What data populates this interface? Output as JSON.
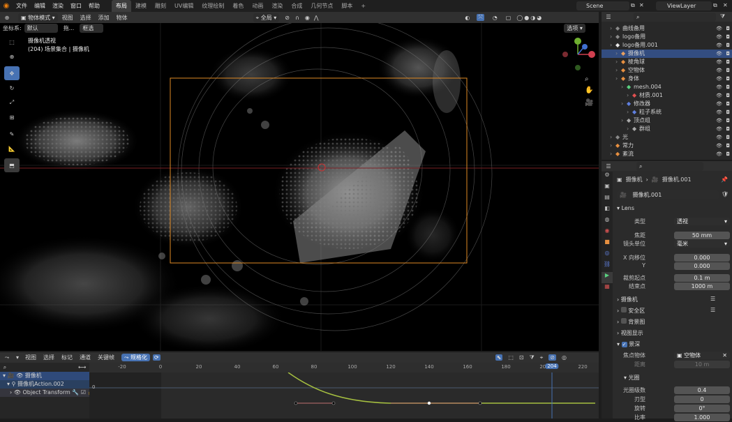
{
  "topbar": {
    "menus": [
      "文件",
      "编辑",
      "渲染",
      "窗口",
      "帮助"
    ],
    "workspaces": [
      "布局",
      "建模",
      "雕刻",
      "UV编辑",
      "纹理绘制",
      "着色",
      "动画",
      "渲染",
      "合成",
      "几何节点",
      "脚本"
    ],
    "active_workspace": "布局",
    "scene": "Scene",
    "view_layer": "ViewLayer"
  },
  "viewport": {
    "mode": "物体模式",
    "menus": [
      "视图",
      "选择",
      "添加",
      "物体"
    ],
    "transform_orientation_label": "坐标系:",
    "transform_orientation": "默认",
    "drag_label": "拖...",
    "select_mode": "框选",
    "pivot": "全局",
    "options": "选项",
    "overlay_title": "摄像机透视",
    "overlay_subtitle": "(204) 场景集合 | 摄像机"
  },
  "outliner": {
    "rows": [
      {
        "label": "曲线备用",
        "indent": 1,
        "icon_color": "#8a8a8a"
      },
      {
        "label": "logo备用",
        "indent": 1,
        "icon_color": "#8a8a8a"
      },
      {
        "label": "logo备用.001",
        "indent": 1,
        "icon_color": "#e8e8e8"
      },
      {
        "label": "摄像机",
        "indent": 2,
        "icon_color": "#e8a060",
        "selected": true
      },
      {
        "label": "棱角球",
        "indent": 2,
        "icon_color": "#e89040"
      },
      {
        "label": "空物体",
        "indent": 2,
        "icon_color": "#e89040"
      },
      {
        "label": "身体",
        "indent": 2,
        "icon_color": "#e89040"
      },
      {
        "label": "mesh.004",
        "indent": 3,
        "icon_color": "#5ad080"
      },
      {
        "label": "材质.001",
        "indent": 4,
        "icon_color": "#e05050"
      },
      {
        "label": "修改器",
        "indent": 3,
        "icon_color": "#6080e0"
      },
      {
        "label": "粒子系统",
        "indent": 4,
        "icon_color": "#6080e0"
      },
      {
        "label": "顶点组",
        "indent": 3,
        "icon_color": "#aaaaaa"
      },
      {
        "label": "群组",
        "indent": 4,
        "icon_color": "#aaaaaa"
      },
      {
        "label": "光",
        "indent": 1,
        "icon_color": "#8a8a8a"
      },
      {
        "label": "常力",
        "indent": 1,
        "icon_color": "#e89040"
      },
      {
        "label": "紊流",
        "indent": 1,
        "icon_color": "#e89040"
      }
    ]
  },
  "properties": {
    "breadcrumb_object": "摄像机",
    "breadcrumb_data": "摄像机.001",
    "data_name": "摄像机.001",
    "lens_panel": "Lens",
    "type_label": "类型",
    "type_value": "透视",
    "focal_label": "焦距",
    "focal_value": "50 mm",
    "unit_label": "镜头单位",
    "unit_value": "毫米",
    "shift_x_label": "X 向移位",
    "shift_x_value": "0.000",
    "shift_y_label": "Y",
    "shift_y_value": "0.000",
    "clip_start_label": "裁剪起点",
    "clip_start_value": "0.1 m",
    "clip_end_label": "结束点",
    "clip_end_value": "1000 m",
    "panels": [
      "摄像机",
      "安全区",
      "背景图",
      "视图显示"
    ],
    "dof_panel": "景深",
    "focus_object_label": "焦点物体",
    "focus_object_value": "空物体",
    "distance_label": "距离",
    "distance_value": "10 m",
    "aperture_panel": "光圈",
    "fstop_label": "光圈级数",
    "fstop_value": "0.4",
    "blades_label": "刃型",
    "blades_value": "0",
    "rotation_label": "旋转",
    "rotation_value": "0°",
    "ratio_label": "比率",
    "ratio_value": "1.000"
  },
  "timeline": {
    "menus": [
      "视图",
      "选择",
      "标记",
      "通道",
      "关键帧"
    ],
    "normalize": "规格化",
    "channels": [
      "摄像机",
      "摄像机Action.002",
      "Object Transform"
    ],
    "ruler_ticks": [
      "-20",
      "0",
      "20",
      "40",
      "60",
      "80",
      "100",
      "120",
      "140",
      "160",
      "180",
      "200",
      "220"
    ],
    "current_frame": "204",
    "y_label": "0"
  }
}
